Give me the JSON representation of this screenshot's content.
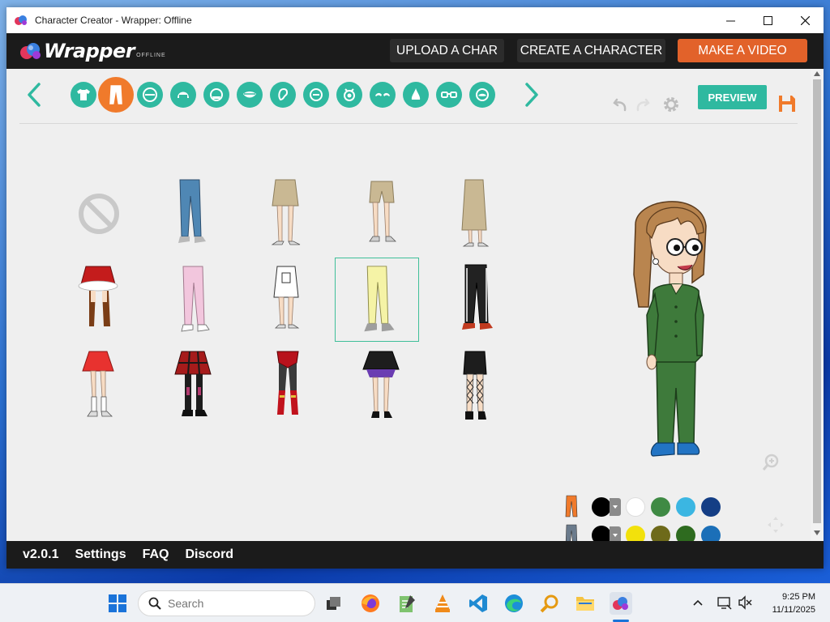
{
  "window": {
    "title": "Character Creator - Wrapper: Offline"
  },
  "header": {
    "logo_text": "Wrapper",
    "logo_sub": "OFFLINE",
    "upload_label": "UPLOAD A CHAR",
    "create_label": "CREATE A CHARACTER",
    "video_label": "MAKE A VIDEO"
  },
  "toolbar": {
    "categories": [
      "upper-body",
      "lower-body",
      "face-shape",
      "hair",
      "back-hair",
      "mouth",
      "ear",
      "mole",
      "eyes",
      "eyebrows",
      "nose",
      "glasses",
      "facial-hair"
    ],
    "active_category": "lower-body",
    "preview_label": "PREVIEW"
  },
  "items": [
    {
      "name": "none"
    },
    {
      "name": "jeans-blue",
      "color": "#4f87b4"
    },
    {
      "name": "skirt-khaki",
      "color": "#c9b893"
    },
    {
      "name": "shorts-khaki",
      "color": "#c9b893"
    },
    {
      "name": "long-skirt-khaki",
      "color": "#c9b893"
    },
    {
      "name": "skirt-red-fur",
      "color": "#c41c1c"
    },
    {
      "name": "pants-pink",
      "color": "#f2c6dd"
    },
    {
      "name": "skirt-white",
      "color": "#ffffff"
    },
    {
      "name": "pants-yellow",
      "color": "#f5f3a6",
      "selected": true
    },
    {
      "name": "pants-black-stripe",
      "color": "#222222"
    },
    {
      "name": "skirt-red-pleated",
      "color": "#e8322f"
    },
    {
      "name": "skirt-plaid-red",
      "color": "#a61b1b"
    },
    {
      "name": "briefs-red-leggings",
      "color": "#b8121c"
    },
    {
      "name": "skirt-black-ruffle",
      "color": "#1d1d1d"
    },
    {
      "name": "skirt-black-fishnet",
      "color": "#1d1d1d"
    }
  ],
  "colors": {
    "row1": [
      "#000000",
      "#ffffff",
      "#3f8a44",
      "#3bb6e2",
      "#143e85"
    ],
    "row2": [
      "#000000",
      "#f2e10c",
      "#6e6a1a",
      "#2e6b1f",
      "#1b6fb8"
    ],
    "row1_part_color": "#f07a2b",
    "row2_part_color": "#6b7b8c"
  },
  "footer": {
    "version": "v2.0.1",
    "settings": "Settings",
    "faq": "FAQ",
    "discord": "Discord"
  },
  "taskbar": {
    "search_placeholder": "Search",
    "time": "9:25 PM",
    "date": "11/11/2025"
  }
}
